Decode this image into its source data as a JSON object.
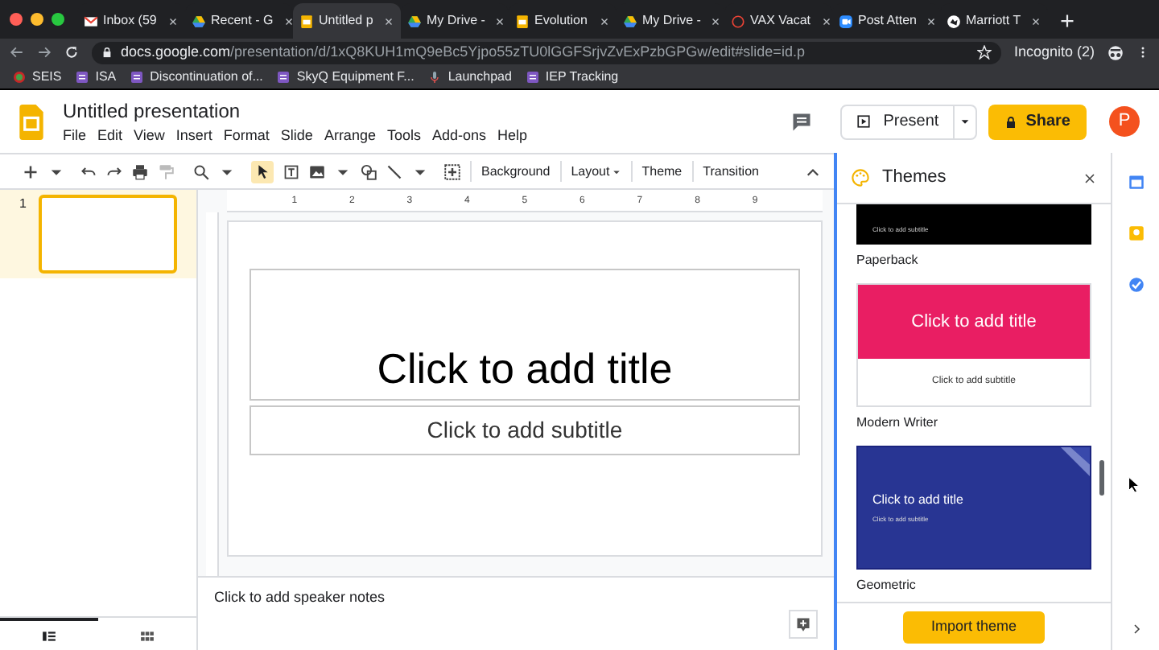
{
  "browser": {
    "tabs": [
      {
        "title": "Inbox (59",
        "kind": "mail",
        "selected": false
      },
      {
        "title": "Recent - G",
        "kind": "drive",
        "selected": false
      },
      {
        "title": "Untitled p",
        "kind": "slides",
        "selected": true
      },
      {
        "title": "My Drive -",
        "kind": "drive",
        "selected": false
      },
      {
        "title": "Evolution",
        "kind": "slides",
        "selected": false
      },
      {
        "title": "My Drive -",
        "kind": "drive",
        "selected": false
      },
      {
        "title": "VAX Vacat",
        "kind": "ring",
        "selected": false
      },
      {
        "title": "Post Atten",
        "kind": "video",
        "selected": false
      },
      {
        "title": "Marriott T",
        "kind": "globe",
        "selected": false
      }
    ],
    "address": {
      "domain": "docs.google.com",
      "path": "/presentation/d/1xQ8KUH1mQ9eBc5Yjpo55zTU0lGGFSrjvZvExPzbGPGw/edit#slide=id.p"
    },
    "profile": "Incognito (2)",
    "bookmarks": [
      {
        "label": "SEIS",
        "kind": "seal"
      },
      {
        "label": "ISA",
        "kind": "form"
      },
      {
        "label": "Discontinuation of...",
        "kind": "form"
      },
      {
        "label": "SkyQ Equipment F...",
        "kind": "form"
      },
      {
        "label": "Launchpad",
        "kind": "mic"
      },
      {
        "label": "IEP Tracking",
        "kind": "form"
      }
    ]
  },
  "app": {
    "title": "Untitled presentation",
    "menu": [
      "File",
      "Edit",
      "View",
      "Insert",
      "Format",
      "Slide",
      "Arrange",
      "Tools",
      "Add-ons",
      "Help"
    ],
    "present": "Present",
    "share": "Share",
    "avatar": "P"
  },
  "toolbar": {
    "select_tool": {
      "selected": true
    },
    "text_buttons": [
      {
        "label": "Background",
        "dropdown": false
      },
      {
        "label": "Layout",
        "dropdown": true
      },
      {
        "label": "Theme",
        "dropdown": false
      },
      {
        "label": "Transition",
        "dropdown": false
      }
    ]
  },
  "filmstrip": {
    "slides": [
      {
        "number": "1",
        "selected": true
      }
    ],
    "views": [
      {
        "kind": "list",
        "selected": true
      },
      {
        "kind": "grid",
        "selected": false
      }
    ]
  },
  "ruler": {
    "labels": [
      "1",
      "2",
      "3",
      "4",
      "5",
      "6",
      "7",
      "8",
      "9"
    ]
  },
  "slide": {
    "title_placeholder": "Click to add title",
    "subtitle_placeholder": "Click to add subtitle"
  },
  "notes": {
    "placeholder": "Click to add speaker notes"
  },
  "themes_panel": {
    "title": "Themes",
    "themes": [
      {
        "name": "Paperback",
        "kind": "paperback",
        "subtitle": "Click to add subtitle"
      },
      {
        "name": "Modern Writer",
        "kind": "modern-writer",
        "title": "Click to add title",
        "subtitle": "Click to add subtitle"
      },
      {
        "name": "Geometric",
        "kind": "geometric",
        "title": "Click to add title",
        "subtitle": "Click to add subtitle"
      }
    ],
    "import_button": "Import theme"
  }
}
